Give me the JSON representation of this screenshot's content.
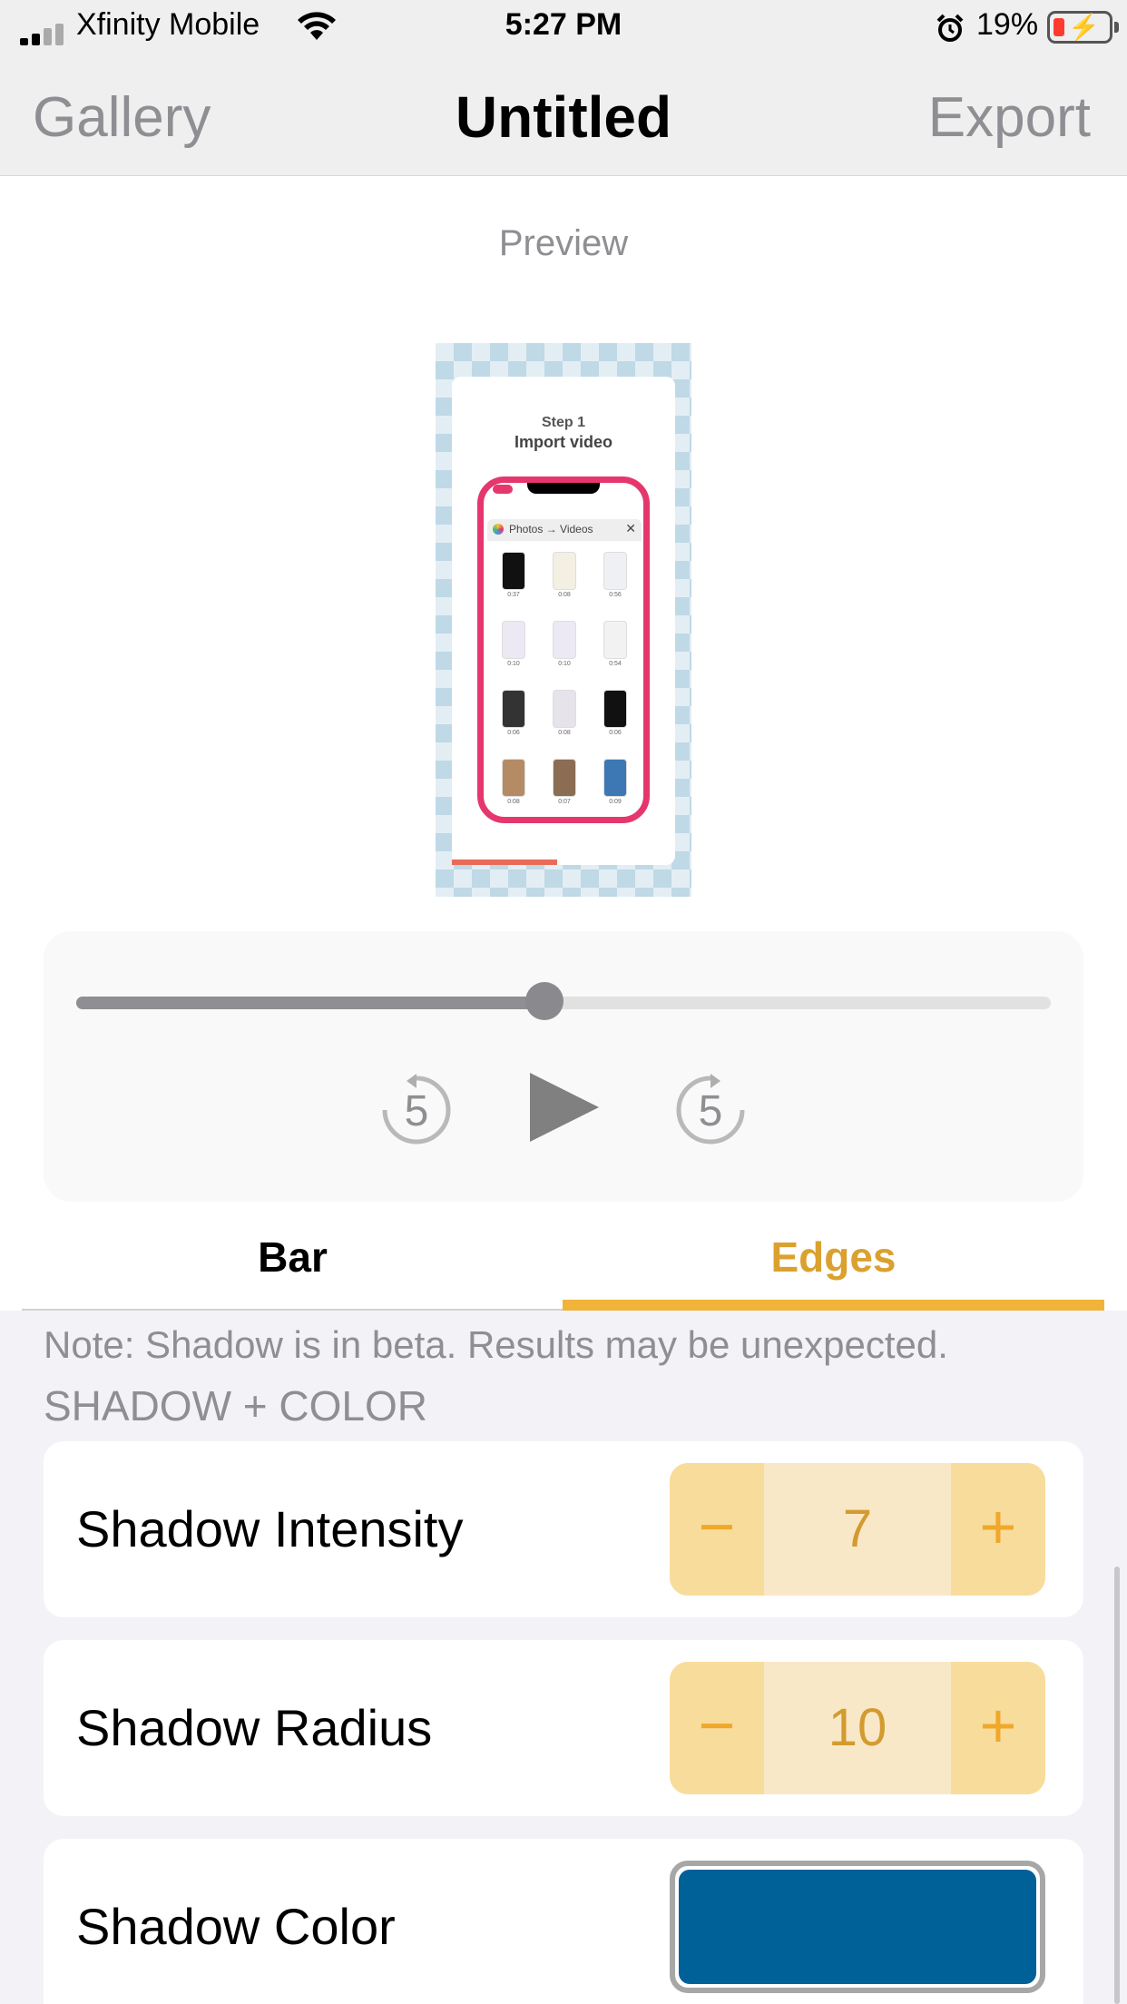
{
  "status_bar": {
    "carrier": "Xfinity Mobile",
    "time": "5:27 PM",
    "battery_percent": "19%",
    "battery_level": 0.19
  },
  "nav": {
    "left": "Gallery",
    "title": "Untitled",
    "right": "Export"
  },
  "preview": {
    "label": "Preview",
    "step": "Step 1",
    "step_title": "Import video",
    "phone_header": "Photos → Videos",
    "thumb_times": [
      "0:37",
      "0:08",
      "0:56",
      "0:10",
      "0:10",
      "0:54",
      "0:06",
      "0:08",
      "0:06",
      "0:08",
      "0:07",
      "0:09"
    ]
  },
  "playback": {
    "progress": 0.48,
    "skip_back_label": "5",
    "skip_forward_label": "5"
  },
  "tabs": {
    "items": [
      "Bar",
      "Edges"
    ],
    "selected": "Edges"
  },
  "note": "Note: Shadow is in beta. Results may be unexpected.",
  "section_header": "SHADOW + COLOR",
  "settings": {
    "intensity": {
      "label": "Shadow Intensity",
      "value": "7"
    },
    "radius": {
      "label": "Shadow Radius",
      "value": "10"
    },
    "color": {
      "label": "Shadow Color",
      "value": "#006199"
    }
  },
  "stepper": {
    "minus": "−",
    "plus": "+"
  },
  "colors": {
    "accent": "#f0b43a",
    "accent_text": "#dba12f",
    "stepper_button": "#f8dc9b",
    "stepper_value_bg": "#f9e8c8",
    "phone_frame": "#e5376e"
  }
}
